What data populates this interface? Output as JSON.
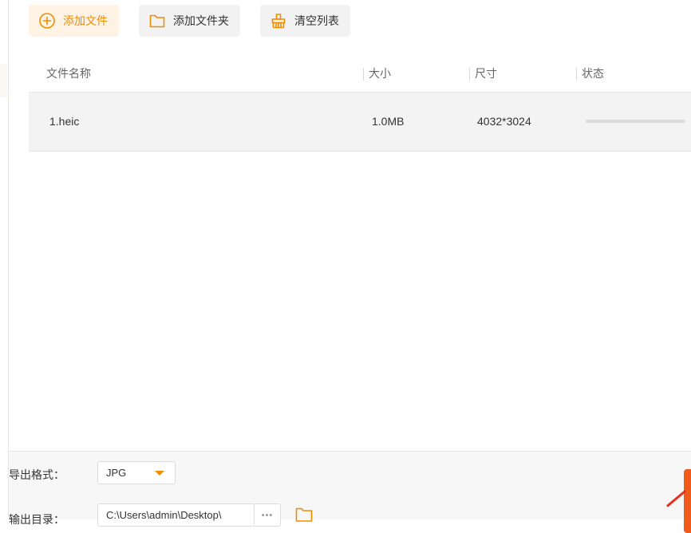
{
  "toolbar": {
    "add_file": "添加文件",
    "add_folder": "添加文件夹",
    "clear_list": "清空列表"
  },
  "table": {
    "columns": [
      "文件名称",
      "大小",
      "尺寸",
      "状态"
    ],
    "rows": [
      {
        "name": "1.heic",
        "size": "1.0MB",
        "dimensions": "4032*3024",
        "progress": 0
      }
    ]
  },
  "output": {
    "format_label": "导出格式：",
    "format_value": "JPG",
    "dir_label": "输出目录：",
    "dir_value": "C:\\Users\\admin\\Desktop\\",
    "browse_dots": "•••"
  },
  "colors": {
    "accent": "#f08c00",
    "accent_bg": "#fff3e5",
    "convert_button": "#f05a1a",
    "annotation_arrow": "#e53020"
  },
  "icons": {
    "add_file": "plus-circle-icon",
    "add_folder": "folder-icon",
    "clear_list": "broom-icon",
    "browse": "folder-icon"
  }
}
